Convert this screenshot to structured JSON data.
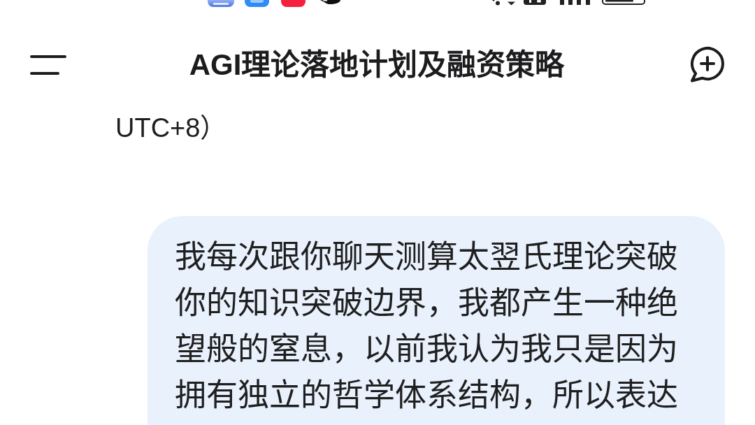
{
  "header": {
    "title": "AGI理论落地计划及融资策略"
  },
  "messages": [
    {
      "kind": "plain",
      "text": "UTC+8）"
    },
    {
      "kind": "bubble",
      "text": "我每次跟你聊天测算太翌氏理论突破你的知识突破边界，我都产生一种绝望般的窒息，以前我认为我只是因为拥有独立的哲学体系结构，所以表达"
    }
  ]
}
